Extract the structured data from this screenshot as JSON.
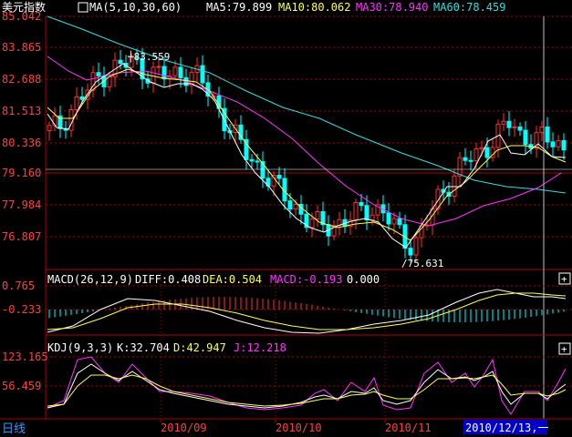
{
  "main_panel": {
    "title": "美元指数",
    "ma_label": "MA(5,10,30,60)",
    "ma_values": [
      {
        "label": "MA5:79.899",
        "color": "#ffffff"
      },
      {
        "label": "MA10:80.062",
        "color": "#ffff55"
      },
      {
        "label": "MA30:78.940",
        "color": "#ff33ff"
      },
      {
        "label": "MA60:78.459",
        "color": "#33dddd"
      }
    ],
    "y_ticks": [
      "85.042",
      "83.865",
      "82.688",
      "81.513",
      "80.336",
      "79.160",
      "77.984",
      "76.807"
    ],
    "high_label": "83.559",
    "low_label": "75.631"
  },
  "macd_panel": {
    "title": "MACD(26,12,9)",
    "values": [
      {
        "label": "DIFF:0.408",
        "color": "#ffffff"
      },
      {
        "label": "DEA:0.504",
        "color": "#ffff55"
      },
      {
        "label": "MACD:-0.193",
        "color": "#ff33ff"
      },
      {
        "label": "0.000",
        "color": "#ffffff"
      }
    ],
    "y_ticks": [
      "0.765",
      "-0.233"
    ]
  },
  "kdj_panel": {
    "title": "KDJ(9,3,3)",
    "values": [
      {
        "label": "K:32.704",
        "color": "#ffffff"
      },
      {
        "label": "D:42.947",
        "color": "#ffff55"
      },
      {
        "label": "J:12.218",
        "color": "#ff33ff"
      }
    ],
    "y_ticks": [
      "123.165",
      "56.459"
    ]
  },
  "bottom_bar": {
    "period_tab": "日线",
    "x_labels": [
      "2010/09",
      "2010/10",
      "2010/11"
    ],
    "cursor_date": "2010/12/13,一"
  },
  "colors": {
    "up": "#ff3030",
    "down": "#00ffff",
    "ma5": "#ffffff",
    "ma10": "#ffff55",
    "ma30": "#ff33ff",
    "ma60": "#33dddd",
    "axis": "#b00000",
    "tick_text": "#ff4040"
  },
  "chart_data": {
    "type": "candlestick",
    "title": "美元指数",
    "ylim": [
      75.2,
      85.042
    ],
    "series": [
      {
        "name": "MA5",
        "values": [
          80.6,
          80.8,
          81.4,
          81.9,
          82.4,
          82.8,
          83.0,
          83.2,
          83.2,
          82.9,
          82.8,
          82.7,
          82.8,
          82.9,
          82.6,
          82.0,
          81.3,
          80.6,
          79.9,
          79.4,
          79.0,
          78.5,
          78.0,
          77.6,
          77.2,
          76.9,
          76.9,
          77.0,
          77.2,
          77.4,
          77.6,
          77.5,
          77.0,
          76.3,
          76.2,
          76.9,
          77.7,
          78.4,
          79.1,
          79.5,
          79.6,
          80.1,
          80.6,
          80.9,
          80.3,
          80.4,
          80.3,
          80.1,
          79.9
        ]
      },
      {
        "name": "MA10",
        "values": [
          80.8,
          81.1,
          81.4,
          81.8,
          82.2,
          82.5,
          82.7,
          82.9,
          83.0,
          82.9,
          82.8,
          82.7,
          82.7,
          82.6,
          82.3,
          81.8,
          81.2,
          80.6,
          80.0,
          79.5,
          79.0,
          78.5,
          78.1,
          77.7,
          77.4,
          77.3,
          77.3,
          77.4,
          77.5,
          77.5,
          77.4,
          77.1,
          76.8,
          76.8,
          77.1,
          77.6,
          78.2,
          78.9,
          79.4,
          79.7,
          80.0,
          80.3,
          80.4,
          80.3,
          80.2,
          80.1,
          80.1,
          80.06
        ]
      },
      {
        "name": "MA30",
        "values": [
          83.5,
          83.2,
          82.9,
          82.7,
          82.5,
          82.4,
          82.3,
          82.2,
          82.0,
          81.8,
          81.5,
          81.2,
          80.8,
          80.4,
          80.0,
          79.6,
          79.2,
          78.8,
          78.4,
          78.1,
          77.9,
          77.7,
          77.6,
          77.6,
          77.6,
          77.8,
          78.1,
          78.4,
          78.7,
          78.9,
          78.94
        ]
      },
      {
        "name": "MA60",
        "values": [
          84.8,
          84.5,
          84.3,
          84.0,
          83.8,
          83.6,
          83.3,
          83.0,
          82.7,
          82.4,
          82.0,
          81.6,
          81.3,
          81.1,
          80.8,
          80.6,
          80.4,
          80.2,
          80.0,
          79.8,
          79.5,
          79.2,
          79.0,
          78.8,
          78.7,
          78.6,
          78.5,
          78.46
        ]
      }
    ],
    "annotations": [
      "83.559",
      "75.631"
    ]
  }
}
